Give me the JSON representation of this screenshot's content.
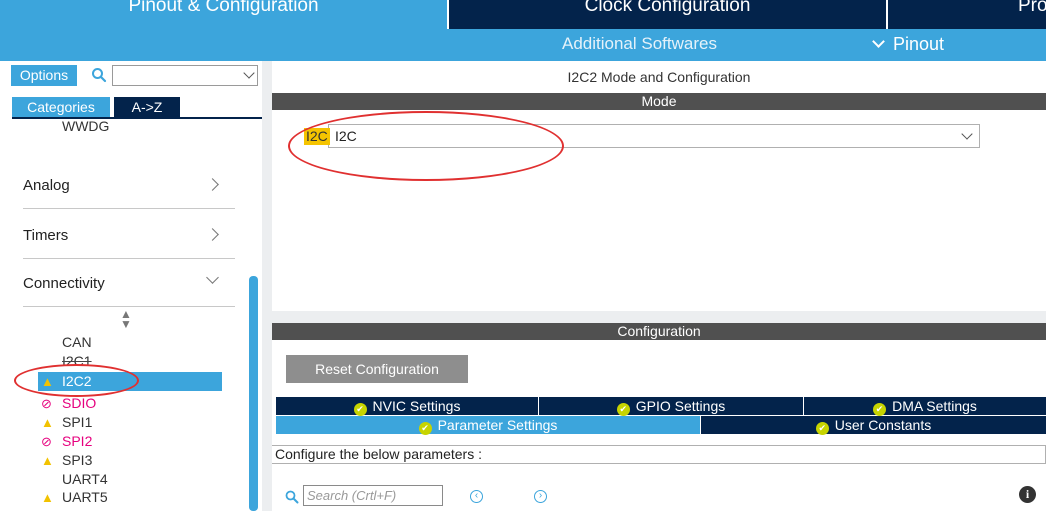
{
  "top_tabs": {
    "pinout": "Pinout & Configuration",
    "clock": "Clock Configuration",
    "project": "Pro"
  },
  "sub_bar": {
    "additional": "Additional Softwares",
    "pinout": "Pinout"
  },
  "left": {
    "options_label": "Options",
    "search_value": "",
    "categories_label": "Categories",
    "az_label": "A->Z",
    "wwdg": "WWDG",
    "groups": [
      {
        "label": "Analog",
        "expanded": false
      },
      {
        "label": "Timers",
        "expanded": false
      },
      {
        "label": "Connectivity",
        "expanded": true
      }
    ],
    "peripherals": [
      {
        "label": "CAN",
        "status": "none"
      },
      {
        "label": "I2C1",
        "status": "none"
      },
      {
        "label": "I2C2",
        "status": "warning",
        "selected": true
      },
      {
        "label": "SDIO",
        "status": "disabled"
      },
      {
        "label": "SPI1",
        "status": "warning"
      },
      {
        "label": "SPI2",
        "status": "disabled"
      },
      {
        "label": "SPI3",
        "status": "warning"
      },
      {
        "label": "UART4",
        "status": "none"
      },
      {
        "label": "UART5",
        "status": "warning"
      }
    ]
  },
  "right": {
    "mode_title": "I2C2 Mode and Configuration",
    "mode_bar": "Mode",
    "i2c_badge": "I2C",
    "i2c_value": "I2C",
    "config_bar": "Configuration",
    "reset_label": "Reset Configuration",
    "tabs_row1": [
      "NVIC Settings",
      "GPIO Settings",
      "DMA Settings"
    ],
    "tabs_row2": [
      "Parameter Settings",
      "User Constants"
    ],
    "active_tab": "Parameter Settings",
    "configure_text": "Configure the below parameters :",
    "search_placeholder": "Search (Crtl+F)"
  },
  "colors": {
    "accent": "#3ca5dc",
    "navy": "#03234b",
    "warning": "#f5c400",
    "disabled": "#e6007e",
    "annotation": "#e03030"
  }
}
